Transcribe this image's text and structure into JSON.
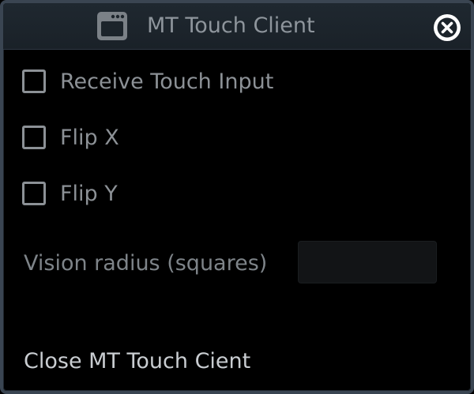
{
  "window": {
    "title": "MT Touch Client",
    "icon": "app-window-icon",
    "close_icon": "close-icon"
  },
  "options": [
    {
      "label": "Receive Touch Input",
      "checked": false
    },
    {
      "label": "Flip X",
      "checked": false
    },
    {
      "label": "Flip Y",
      "checked": false
    }
  ],
  "vision_radius": {
    "label": "Vision radius (squares)",
    "value": ""
  },
  "footer": {
    "close_label": "Close MT Touch Cient"
  },
  "colors": {
    "background": "#000000",
    "titlebar": "#1c242b",
    "border": "#3a4552",
    "text_dim": "#8c9196",
    "text_bright": "#c9cdd1"
  }
}
